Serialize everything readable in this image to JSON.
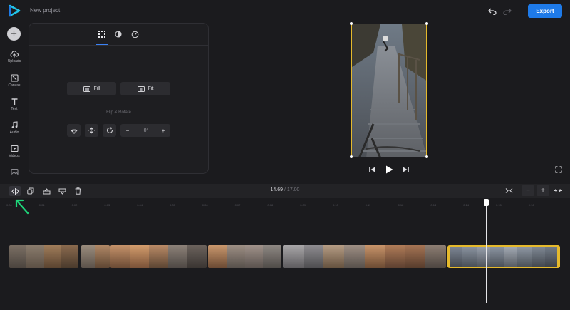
{
  "header": {
    "title": "New project",
    "export_label": "Export"
  },
  "sidebar": {
    "items": [
      {
        "label": "Uploads",
        "icon": "cloud-upload-icon"
      },
      {
        "label": "Canvas",
        "icon": "canvas-icon"
      },
      {
        "label": "Text",
        "icon": "text-icon"
      },
      {
        "label": "Audio",
        "icon": "music-icon"
      },
      {
        "label": "Videos",
        "icon": "video-icon"
      },
      {
        "label": "",
        "icon": "image-icon"
      }
    ]
  },
  "panel": {
    "tabs": [
      "grid-icon",
      "contrast-icon",
      "speed-icon"
    ],
    "fill_label": "Fill",
    "fit_label": "Fit",
    "flip_rotate_label": "Flip & Rotate",
    "rotate_value": "0°",
    "minus": "−",
    "plus": "+"
  },
  "timeline": {
    "current_time": "14.69",
    "separator": "/",
    "duration": "17.00",
    "zoom_minus": "−",
    "zoom_plus": "+",
    "ticks": [
      "0:00",
      "0:01",
      "0:02",
      "0:03",
      "0:04",
      "0:05",
      "0:06",
      "0:07",
      "0:08",
      "0:09",
      "0:10",
      "0:11",
      "0:12",
      "0:13",
      "0:14",
      "0:15",
      "0:16"
    ]
  },
  "colors": {
    "accent": "#1e7ae8",
    "selection": "#e5b92c",
    "annotation_arrow": "#1ed67a"
  }
}
